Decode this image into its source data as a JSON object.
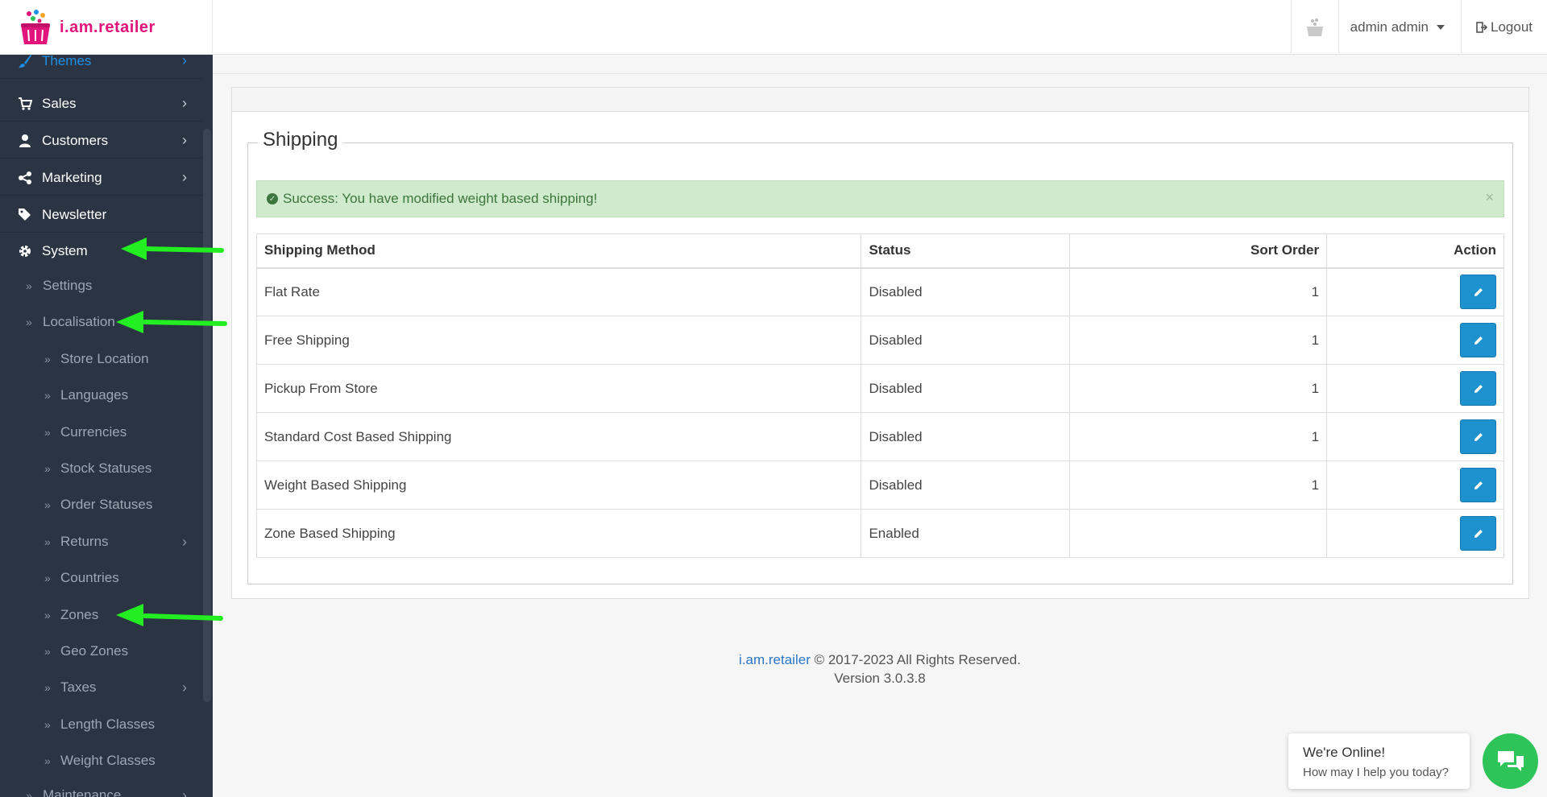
{
  "brand": {
    "name": "i.am.retailer"
  },
  "header": {
    "user_label": "admin admin",
    "logout_label": "Logout"
  },
  "sidebar": {
    "items": [
      {
        "label": "Themes",
        "icon": "brush-icon"
      },
      {
        "label": "Sales",
        "icon": "cart-icon"
      },
      {
        "label": "Customers",
        "icon": "user-icon"
      },
      {
        "label": "Marketing",
        "icon": "share-icon"
      },
      {
        "label": "Newsletter",
        "icon": "tags-icon"
      },
      {
        "label": "System",
        "icon": "gear-icon"
      }
    ],
    "system_children": [
      "Settings",
      "Localisation"
    ],
    "localisation_children": [
      "Store Location",
      "Languages",
      "Currencies",
      "Stock Statuses",
      "Order Statuses",
      "Returns",
      "Countries",
      "Zones",
      "Geo Zones",
      "Taxes",
      "Length Classes",
      "Weight Classes"
    ],
    "more_item": "Maintenance"
  },
  "content": {
    "legend": "Shipping",
    "alert": "Success: You have modified weight based shipping!",
    "columns": [
      "Shipping Method",
      "Status",
      "Sort Order",
      "Action"
    ],
    "rows": [
      {
        "method": "Flat Rate",
        "status": "Disabled",
        "sort": "1"
      },
      {
        "method": "Free Shipping",
        "status": "Disabled",
        "sort": "1"
      },
      {
        "method": "Pickup From Store",
        "status": "Disabled",
        "sort": "1"
      },
      {
        "method": "Standard Cost Based Shipping",
        "status": "Disabled",
        "sort": "1"
      },
      {
        "method": "Weight Based Shipping",
        "status": "Disabled",
        "sort": "1"
      },
      {
        "method": "Zone Based Shipping",
        "status": "Enabled",
        "sort": ""
      }
    ]
  },
  "footer": {
    "brand_link": "i.am.retailer",
    "copyright": "© 2017-2023 All Rights Reserved.",
    "version": "Version 3.0.3.8"
  },
  "chat": {
    "title": "We're Online!",
    "subtitle": "How may I help you today?"
  },
  "colors": {
    "brand": "#e0147a",
    "sidebar_bg": "#2b3443",
    "accent": "#1e91cf",
    "success_bg": "#cfeacd",
    "arrow": "#22ee22",
    "chat": "#2fc45a"
  }
}
